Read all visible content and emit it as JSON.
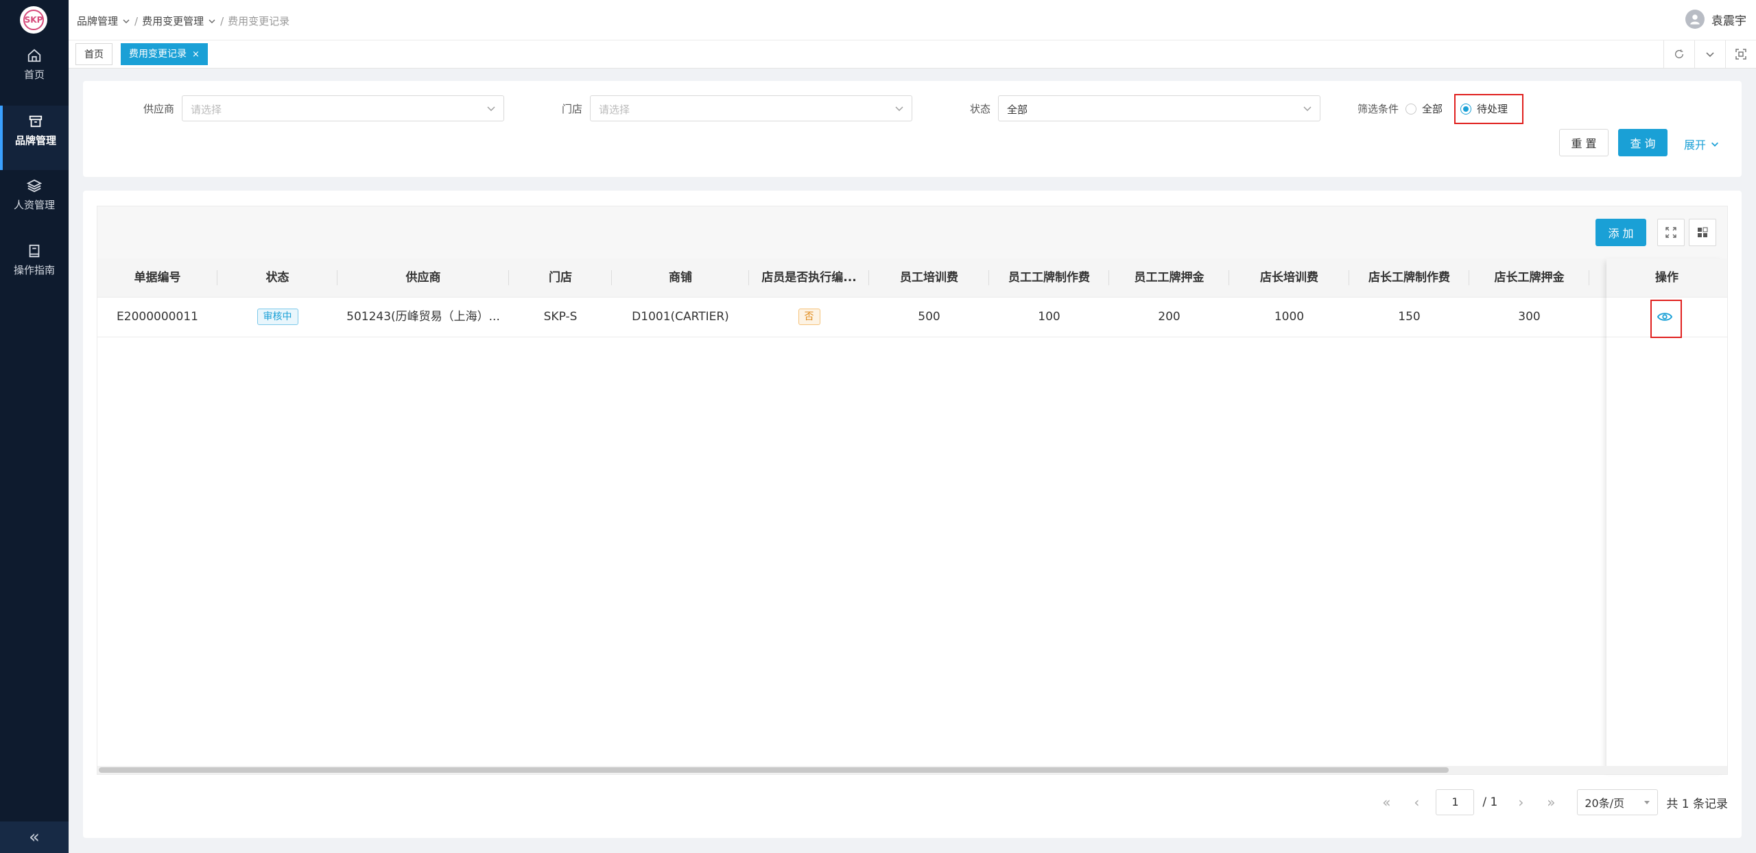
{
  "sidebar": {
    "logo_text": "SKP",
    "items": [
      {
        "label": "首页",
        "icon": "home-icon"
      },
      {
        "label": "品牌管理",
        "icon": "archive-icon",
        "active": true
      },
      {
        "label": "人资管理",
        "icon": "layers-icon"
      },
      {
        "label": "操作指南",
        "icon": "book-icon"
      }
    ],
    "collapse_label": "«"
  },
  "header": {
    "breadcrumb": [
      "品牌管理",
      "费用变更管理",
      "费用变更记录"
    ],
    "user_name": "袁震宇"
  },
  "tabs": [
    {
      "label": "首页"
    },
    {
      "label": "费用变更记录",
      "active": true,
      "close": "×"
    }
  ],
  "filters": {
    "supplier": {
      "label": "供应商",
      "placeholder": "请选择"
    },
    "store": {
      "label": "门店",
      "placeholder": "请选择"
    },
    "status": {
      "label": "状态",
      "value": "全部"
    },
    "condition": {
      "label": "筛选条件",
      "options": [
        "全部",
        "待处理"
      ],
      "selected": "待处理"
    },
    "reset_label": "重 置",
    "query_label": "查 询",
    "expand_label": "展开"
  },
  "table": {
    "add_label": "添 加",
    "columns": [
      "单据编号",
      "状态",
      "供应商",
      "门店",
      "商铺",
      "店员是否执行编...",
      "员工培训费",
      "员工工牌制作费",
      "员工工牌押金",
      "店长培训费",
      "店长工牌制作费",
      "店长工牌押金",
      "操作"
    ],
    "rows": [
      {
        "id": "E2000000011",
        "status": "审核中",
        "supplier": "501243(历峰贸易（上海）...",
        "store": "SKP-S",
        "shop": "D1001(CARTIER)",
        "exec": "否",
        "staff_training": "500",
        "staff_badge": "100",
        "staff_deposit": "200",
        "mgr_training": "1000",
        "mgr_badge": "150",
        "mgr_deposit": "300"
      }
    ]
  },
  "pagination": {
    "current": "1",
    "total_pages": "/ 1",
    "page_size": "20条/页",
    "total": "共 1 条记录"
  },
  "colors": {
    "accent": "#1aa0d6",
    "sidebar": "#0e1b2e",
    "highlight": "#e0201e"
  }
}
